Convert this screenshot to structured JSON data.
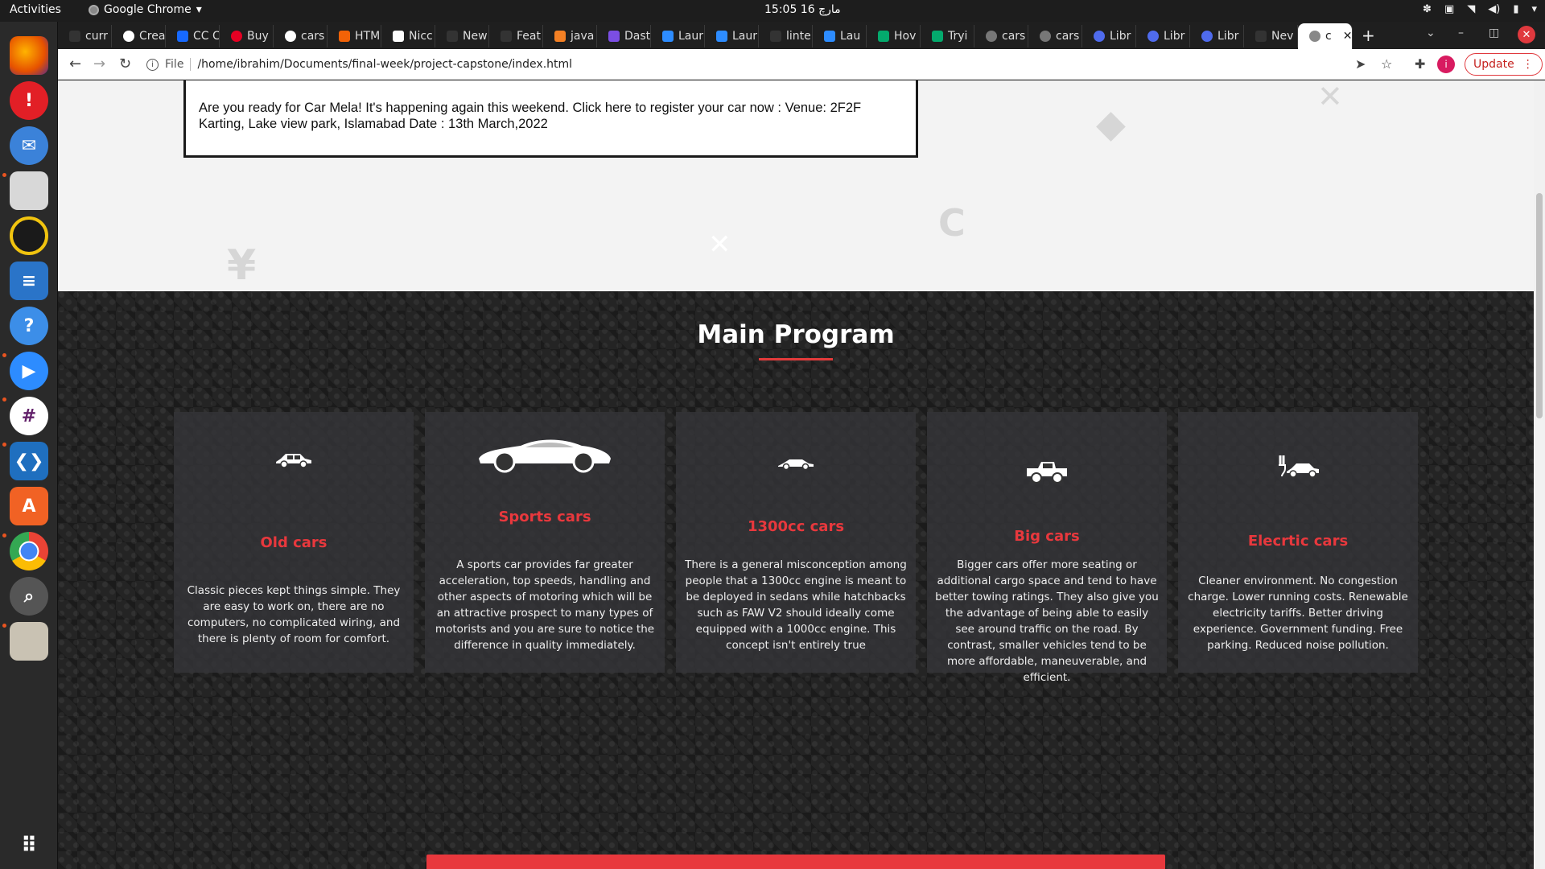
{
  "system": {
    "activities": "Activities",
    "app_name": "Google Chrome",
    "clock": "15:05  16 مارچ"
  },
  "browser": {
    "tabs": [
      {
        "label": "curr"
      },
      {
        "label": "Crea"
      },
      {
        "label": "CC C"
      },
      {
        "label": "Buy"
      },
      {
        "label": "cars"
      },
      {
        "label": "HTM"
      },
      {
        "label": "Nicc"
      },
      {
        "label": "New"
      },
      {
        "label": "Feat"
      },
      {
        "label": "java"
      },
      {
        "label": "Dast"
      },
      {
        "label": "Laur"
      },
      {
        "label": "Laur"
      },
      {
        "label": "linte"
      },
      {
        "label": "Lau"
      },
      {
        "label": "Hov"
      },
      {
        "label": "Tryi"
      },
      {
        "label": "cars"
      },
      {
        "label": "cars"
      },
      {
        "label": "Libr"
      },
      {
        "label": "Libr"
      },
      {
        "label": "Libr"
      },
      {
        "label": "Nev"
      },
      {
        "label": "c"
      }
    ],
    "address_scheme": "File",
    "address_url": "/home/ibrahim/Documents/final-week/project-capstone/index.html",
    "profile_initial": "i",
    "update_label": "Update"
  },
  "page": {
    "announcement": "Are you ready for Car Mela! It's happening again this weekend. Click here to register your car now : Venue: 2F2F Karting, Lake view park, Islamabad Date : 13th March,2022",
    "section_title": "Main Program",
    "cards": [
      {
        "title": "Old cars",
        "text": "Classic pieces kept things simple. They are easy to work on, there are no computers, no complicated wiring, and there is plenty of room for comfort."
      },
      {
        "title": "Sports cars",
        "text": "A sports car provides far greater acceleration, top speeds, handling and other aspects of motoring which will be an attractive prospect to many types of motorists and you are sure to notice the difference in quality immediately."
      },
      {
        "title": "1300cc cars",
        "text": "There is a general misconception among people that a 1300cc engine is meant to be deployed in sedans while hatchbacks such as FAW V2 should ideally come equipped with a 1000cc engine. This concept isn't entirely true"
      },
      {
        "title": "Big cars",
        "text": "Bigger cars offer more seating or additional cargo space and tend to have better towing ratings. They also give you the advantage of being able to easily see around traffic on the road. By contrast, smaller vehicles tend to be more affordable, maneuverable, and efficient."
      },
      {
        "title": "Elecrtic cars",
        "text": "Cleaner environment. No congestion charge. Lower running costs. Renewable electricity tariffs. Better driving experience. Government funding. Free parking. Reduced noise pollution."
      }
    ]
  },
  "colors": {
    "accent": "#e8383d",
    "dark_bg": "#242424",
    "card_bg": "#343438"
  }
}
